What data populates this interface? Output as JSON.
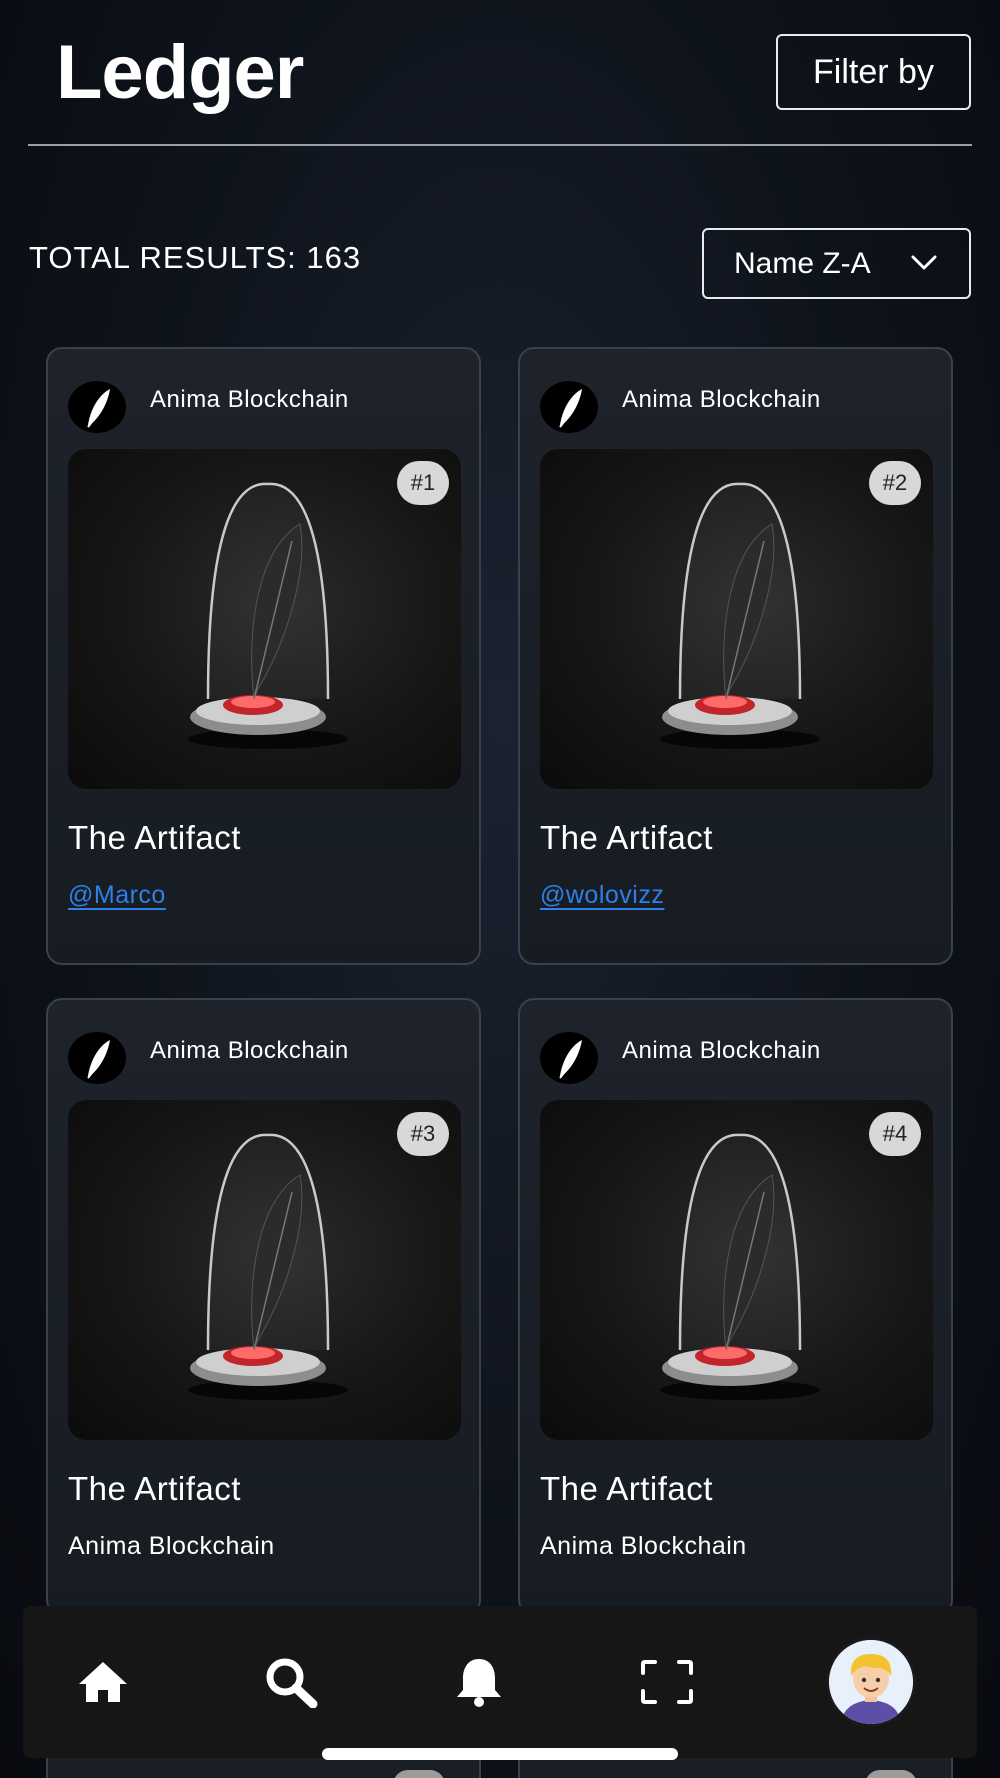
{
  "header": {
    "title": "Ledger",
    "filter_label": "Filter by"
  },
  "results": {
    "count_text": "TOTAL RESULTS: 163"
  },
  "sort": {
    "selected": "Name Z-A"
  },
  "cards": [
    {
      "chain": "Anima Blockchain",
      "badge": "#1",
      "title": "The Artifact",
      "subtitle": "@Marco",
      "subtitle_is_link": true
    },
    {
      "chain": "Anima Blockchain",
      "badge": "#2",
      "title": "The Artifact",
      "subtitle": "@wolovizz",
      "subtitle_is_link": true
    },
    {
      "chain": "Anima Blockchain",
      "badge": "#3",
      "title": "The Artifact",
      "subtitle": "Anima Blockchain",
      "subtitle_is_link": false
    },
    {
      "chain": "Anima Blockchain",
      "badge": "#4",
      "title": "The Artifact",
      "subtitle": "Anima Blockchain",
      "subtitle_is_link": false
    }
  ],
  "tabbar": {
    "items": [
      {
        "icon": "home-icon"
      },
      {
        "icon": "search-icon"
      },
      {
        "icon": "bell-icon"
      },
      {
        "icon": "scan-icon"
      },
      {
        "icon": "avatar"
      }
    ]
  },
  "colors": {
    "link": "#2f7fe6",
    "background": "#0b0e14",
    "card_border": "#3a414b",
    "badge_bg": "#d8d8d8"
  }
}
